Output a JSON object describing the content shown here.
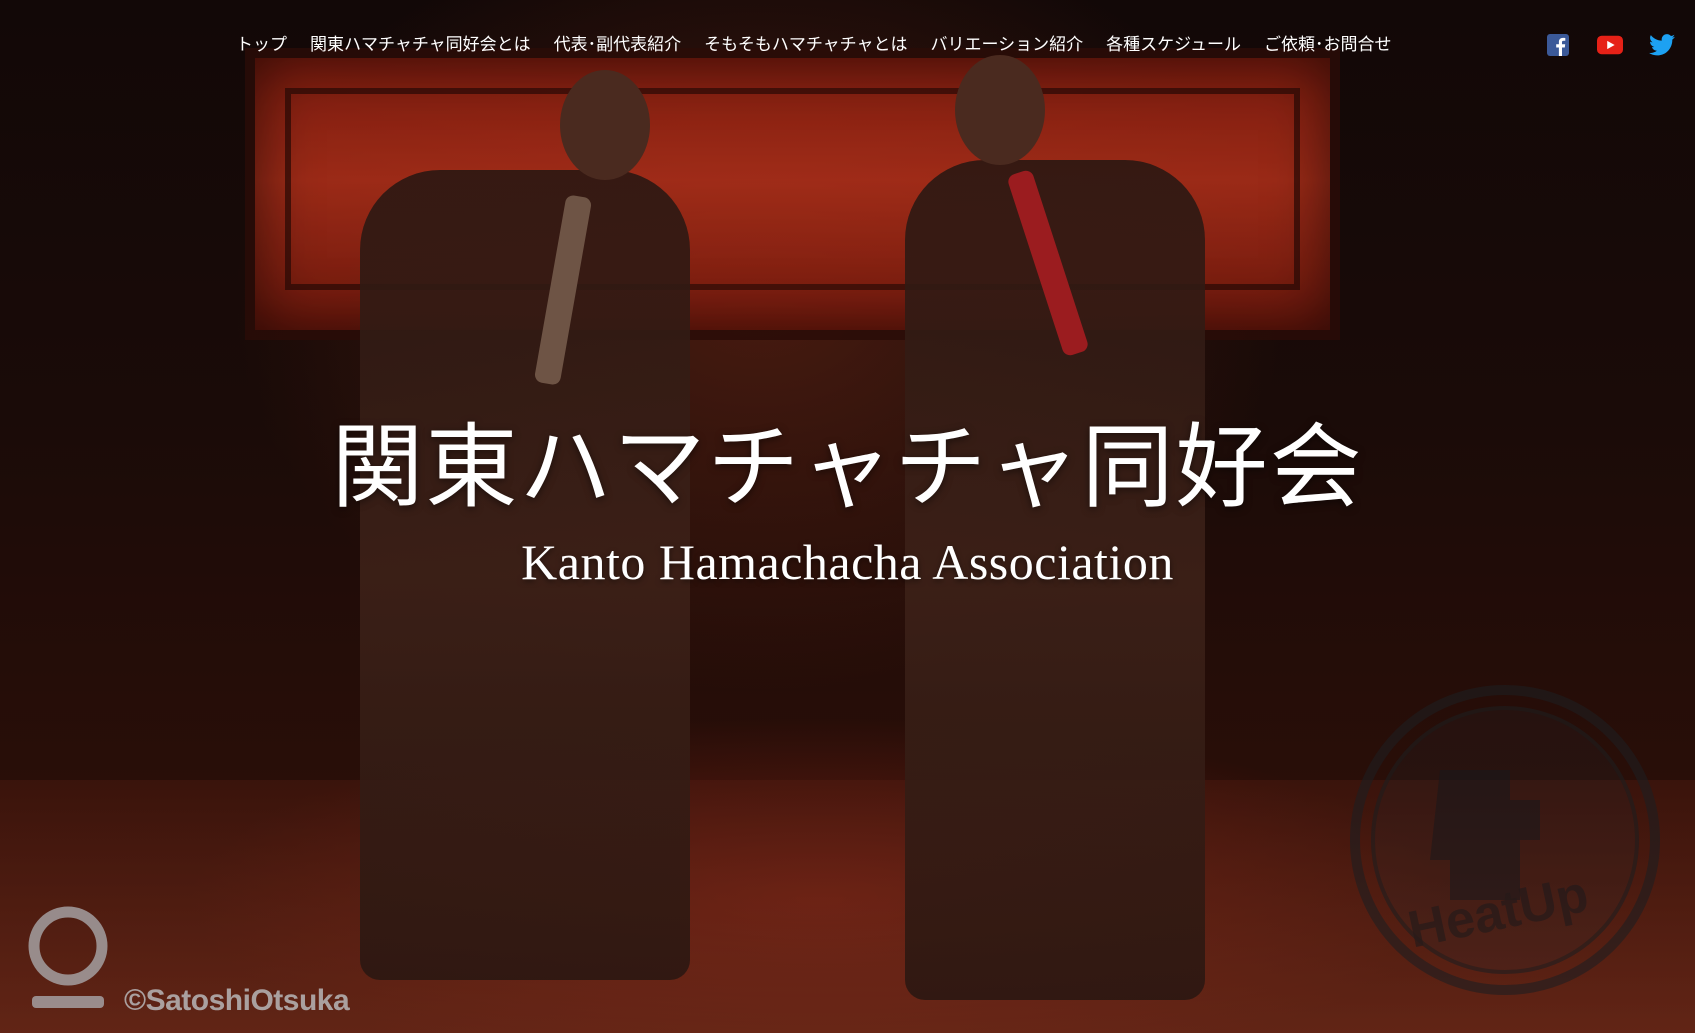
{
  "nav": {
    "items": [
      {
        "label": "トップ"
      },
      {
        "label": "関東ハマチャチャ同好会とは"
      },
      {
        "label": "代表･副代表紹介"
      },
      {
        "label": "そもそもハマチャチャとは"
      },
      {
        "label": "バリエーション紹介"
      },
      {
        "label": "各種スケジュール"
      },
      {
        "label": "ご依頼･お問合せ"
      }
    ],
    "social": [
      {
        "icon": "facebook-icon",
        "color": "#3b5998"
      },
      {
        "icon": "youtube-icon",
        "color": "#e62117"
      },
      {
        "icon": "twitter-icon",
        "color": "#1da1f2"
      }
    ]
  },
  "hero": {
    "title": "関東ハマチャチャ同好会",
    "subtitle": "Kanto Hamachacha Association"
  },
  "photo": {
    "credit": "©SatoshiOtsuka",
    "stamp_text": "HeatUp"
  }
}
